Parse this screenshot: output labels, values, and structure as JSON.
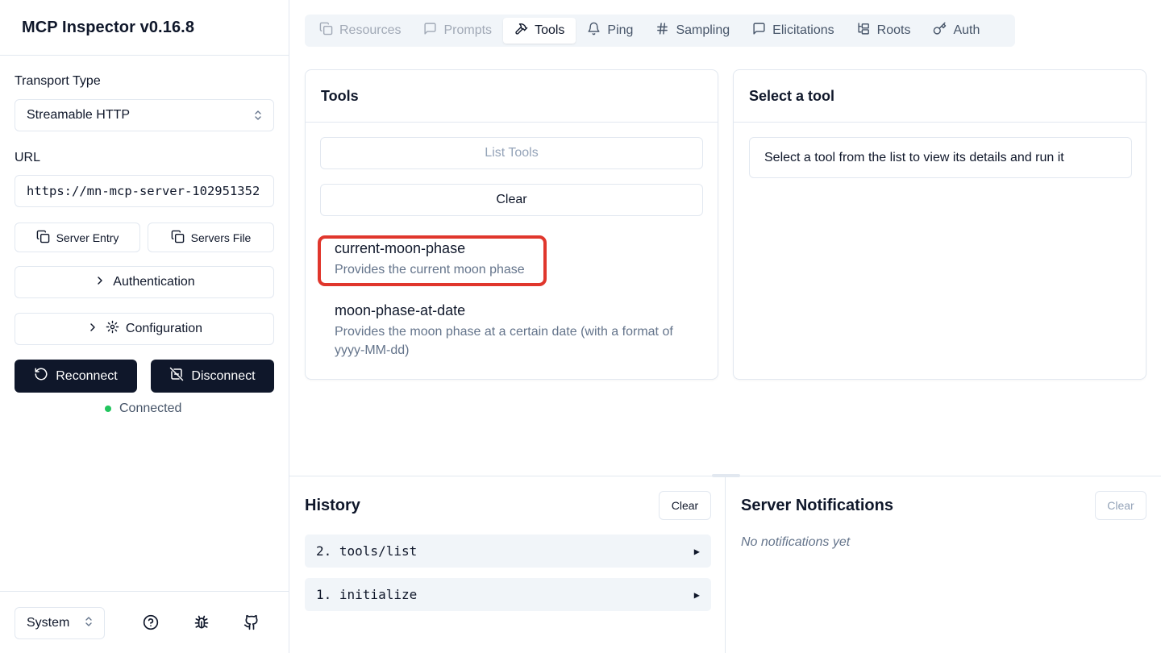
{
  "app": {
    "title": "MCP Inspector v0.16.8"
  },
  "sidebar": {
    "transport_label": "Transport Type",
    "transport_value": "Streamable HTTP",
    "url_label": "URL",
    "url_value": "https://mn-mcp-server-102951352",
    "server_entry_label": "Server Entry",
    "servers_file_label": "Servers File",
    "authentication_label": "Authentication",
    "configuration_label": "Configuration",
    "reconnect_label": "Reconnect",
    "disconnect_label": "Disconnect",
    "status_text": "Connected",
    "status_color": "#22c55e",
    "theme_value": "System"
  },
  "tabs": [
    {
      "label": "Resources",
      "icon": "copy-icon",
      "state": "disabled"
    },
    {
      "label": "Prompts",
      "icon": "message-square-icon",
      "state": "disabled"
    },
    {
      "label": "Tools",
      "icon": "hammer-icon",
      "state": "active"
    },
    {
      "label": "Ping",
      "icon": "bell-icon",
      "state": "normal"
    },
    {
      "label": "Sampling",
      "icon": "hash-icon",
      "state": "normal"
    },
    {
      "label": "Elicitations",
      "icon": "message-square-icon",
      "state": "normal"
    },
    {
      "label": "Roots",
      "icon": "folder-tree-icon",
      "state": "normal"
    },
    {
      "label": "Auth",
      "icon": "key-icon",
      "state": "normal"
    }
  ],
  "tools_panel": {
    "title": "Tools",
    "list_tools_label": "List Tools",
    "clear_label": "Clear",
    "items": [
      {
        "name": "current-moon-phase",
        "description": "Provides the current moon phase",
        "highlighted": true
      },
      {
        "name": "moon-phase-at-date",
        "description": "Provides the moon phase at a certain date (with a format of yyyy-MM-dd)",
        "highlighted": false
      }
    ],
    "highlight_color": "#e0362c"
  },
  "detail_panel": {
    "title": "Select a tool",
    "message": "Select a tool from the list to view its details and run it"
  },
  "history": {
    "title": "History",
    "clear_label": "Clear",
    "entries": [
      {
        "label": "2. tools/list"
      },
      {
        "label": "1. initialize"
      }
    ]
  },
  "notifications": {
    "title": "Server Notifications",
    "clear_label": "Clear",
    "empty_text": "No notifications yet"
  }
}
